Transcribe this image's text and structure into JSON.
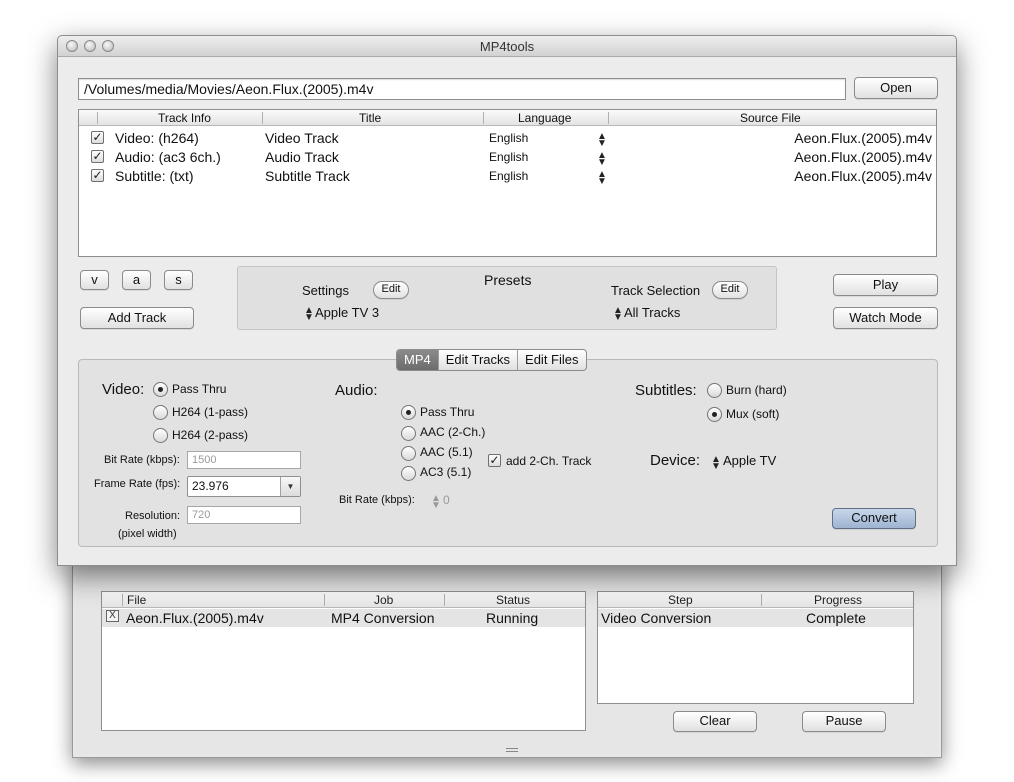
{
  "window": {
    "title": "MP4tools"
  },
  "source_path": "/Volumes/media/Movies/Aeon.Flux.(2005).m4v",
  "buttons": {
    "open": "Open",
    "v": "v",
    "a": "a",
    "s": "s",
    "add_track": "Add Track",
    "play": "Play",
    "watch_mode": "Watch Mode",
    "convert": "Convert",
    "clear": "Clear",
    "pause": "Pause"
  },
  "tracks": {
    "headers": [
      "Track Info",
      "Title",
      "Language",
      "Source File"
    ],
    "rows": [
      {
        "checked": true,
        "info": "Video: (h264)",
        "title": "Video Track",
        "language": "English",
        "source": "Aeon.Flux.(2005).m4v"
      },
      {
        "checked": true,
        "info": "Audio: (ac3 6ch.)",
        "title": "Audio Track",
        "language": "English",
        "source": "Aeon.Flux.(2005).m4v"
      },
      {
        "checked": true,
        "info": "Subtitle: (txt)",
        "title": "Subtitle Track",
        "language": "English",
        "source": "Aeon.Flux.(2005).m4v"
      }
    ]
  },
  "presets": {
    "heading": "Presets",
    "settings_label": "Settings",
    "settings_value": "Apple TV 3",
    "track_selection_label": "Track Selection",
    "track_selection_value": "All Tracks",
    "edit": "Edit"
  },
  "tabs": [
    "MP4",
    "Edit Tracks",
    "Edit Files"
  ],
  "selected_tab": "MP4",
  "video": {
    "label": "Video:",
    "options": [
      "Pass Thru",
      "H264 (1-pass)",
      "H264 (2-pass)"
    ],
    "selected": "Pass Thru",
    "bitrate_label": "Bit Rate (kbps):",
    "bitrate_value": "1500",
    "framerate_label": "Frame Rate (fps):",
    "framerate_value": "23.976",
    "resolution_label": "Resolution:",
    "resolution_value": "720",
    "resolution_note": "(pixel width)"
  },
  "audio": {
    "label": "Audio:",
    "options": [
      "Pass Thru",
      "AAC (2-Ch.)",
      "AAC (5.1)",
      "AC3 (5.1)"
    ],
    "selected": "Pass Thru",
    "add_2ch_label": "add 2-Ch. Track",
    "add_2ch_checked": true,
    "bitrate_label": "Bit Rate (kbps):",
    "bitrate_value": "0"
  },
  "subtitles": {
    "label": "Subtitles:",
    "options": [
      "Burn (hard)",
      "Mux (soft)"
    ],
    "selected": "Mux (soft)"
  },
  "device": {
    "label": "Device:",
    "value": "Apple TV"
  },
  "queue": {
    "headers": [
      "File",
      "Job",
      "Status"
    ],
    "rows": [
      {
        "remove": "X",
        "file": "Aeon.Flux.(2005).m4v",
        "job": "MP4 Conversion",
        "status": "Running"
      }
    ]
  },
  "steps": {
    "headers": [
      "Step",
      "Progress"
    ],
    "rows": [
      {
        "step": "Video Conversion",
        "progress": "Complete"
      }
    ]
  }
}
